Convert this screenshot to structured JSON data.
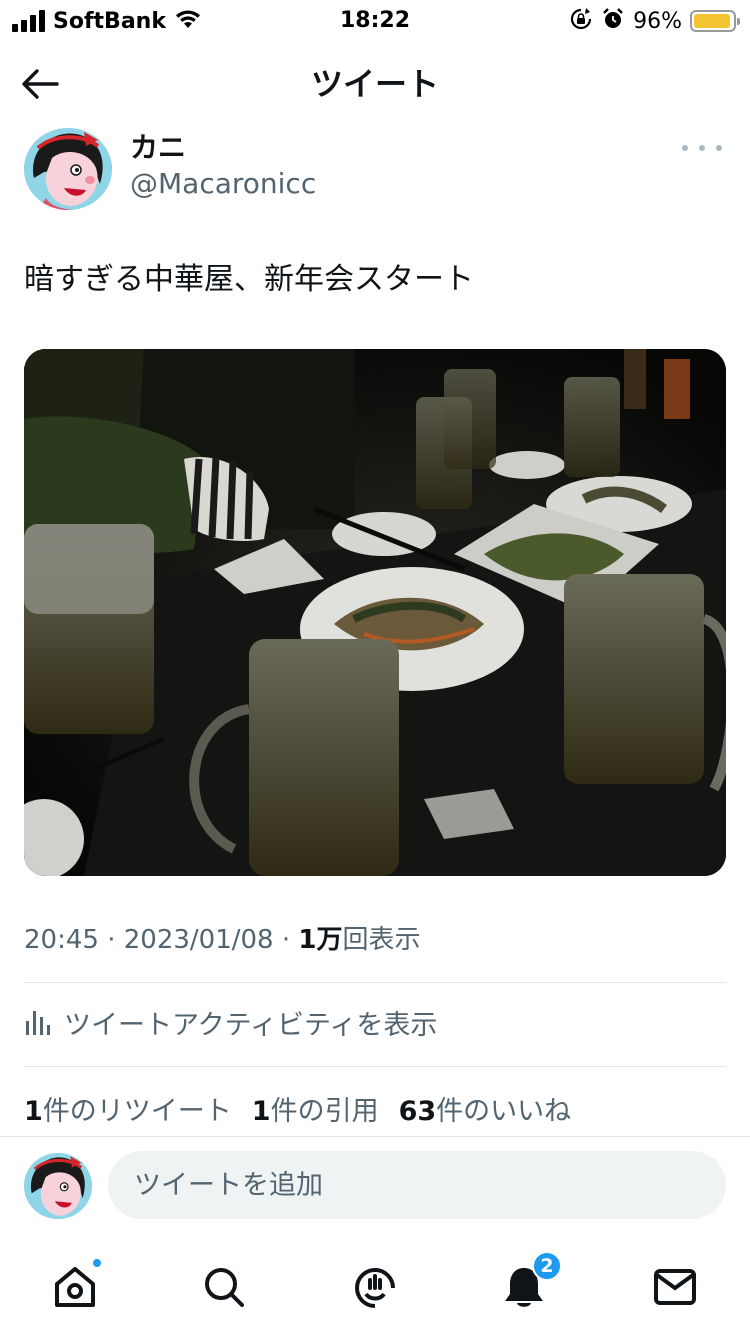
{
  "status_bar": {
    "carrier": "SoftBank",
    "time": "18:22",
    "battery_percent": "96%",
    "battery_level": 0.96,
    "icons": [
      "signal-icon",
      "wifi-icon",
      "rotation-lock-icon",
      "alarm-icon",
      "battery-icon"
    ]
  },
  "header": {
    "back_icon": "arrow-left-icon",
    "title": "ツイート"
  },
  "author": {
    "name": "カニ",
    "handle": "@Macaronicc",
    "more_icon": "more-horizontal-icon"
  },
  "tweet": {
    "text": "暗すぎる中華屋、新年会スタート",
    "time": "20:45",
    "separator": "·",
    "date": "2023/01/08",
    "views_count": "1万",
    "views_label": "回表示"
  },
  "activity": {
    "icon": "bar-chart-icon",
    "label": "ツイートアクティビティを表示"
  },
  "stats": {
    "retweets_count": "1",
    "retweets_label": "件のリツイート",
    "quotes_count": "1",
    "quotes_label": "件の引用",
    "likes_count": "63",
    "likes_label": "件のいいね"
  },
  "reply": {
    "placeholder": "ツイートを追加"
  },
  "tabbar": {
    "items": [
      {
        "icon": "home-icon",
        "has_dot": true
      },
      {
        "icon": "search-icon"
      },
      {
        "icon": "spaces-icon"
      },
      {
        "icon": "notifications-icon",
        "badge": "2"
      },
      {
        "icon": "messages-icon"
      }
    ]
  },
  "colors": {
    "accent": "#1d9bf0",
    "secondary_text": "#536471",
    "battery": "#f5c431"
  }
}
